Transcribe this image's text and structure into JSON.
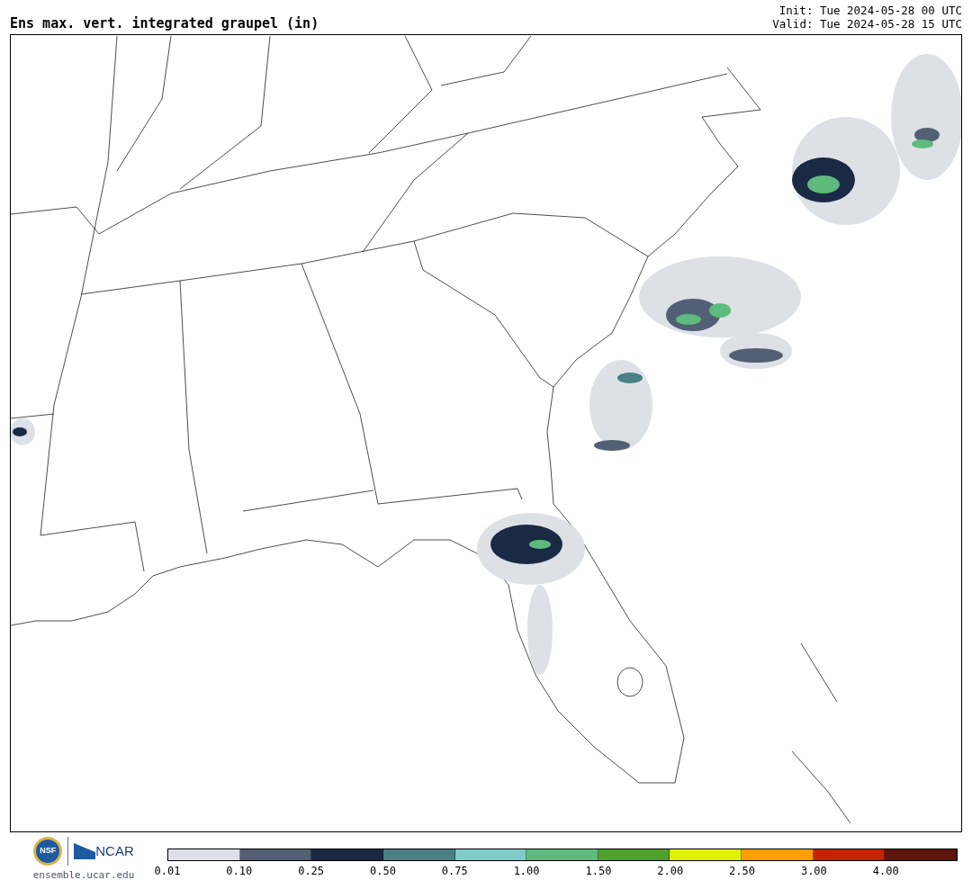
{
  "title": "Ens max. vert. integrated graupel (in)",
  "init": "Init: Tue 2024-05-28 00 UTC",
  "valid": "Valid: Tue 2024-05-28 15 UTC",
  "logos": {
    "nsf": "NSF",
    "ncar": "NCAR"
  },
  "footer": "ensemble.ucar.edu",
  "legend": [
    {
      "label": "0.01",
      "color": "#dde1e6"
    },
    {
      "label": "0.10",
      "color": "#525f74"
    },
    {
      "label": "0.25",
      "color": "#1a2a44"
    },
    {
      "label": "0.50",
      "color": "#4a7f85"
    },
    {
      "label": "0.75",
      "color": "#7fcdc9"
    },
    {
      "label": "1.00",
      "color": "#5fba7d"
    },
    {
      "label": "1.50",
      "color": "#4fa22a"
    },
    {
      "label": "2.00",
      "color": "#e1f000"
    },
    {
      "label": "2.50",
      "color": "#ff9e00"
    },
    {
      "label": "3.00",
      "color": "#c42200"
    },
    {
      "label": "4.00",
      "color": "#5e150c"
    }
  ]
}
